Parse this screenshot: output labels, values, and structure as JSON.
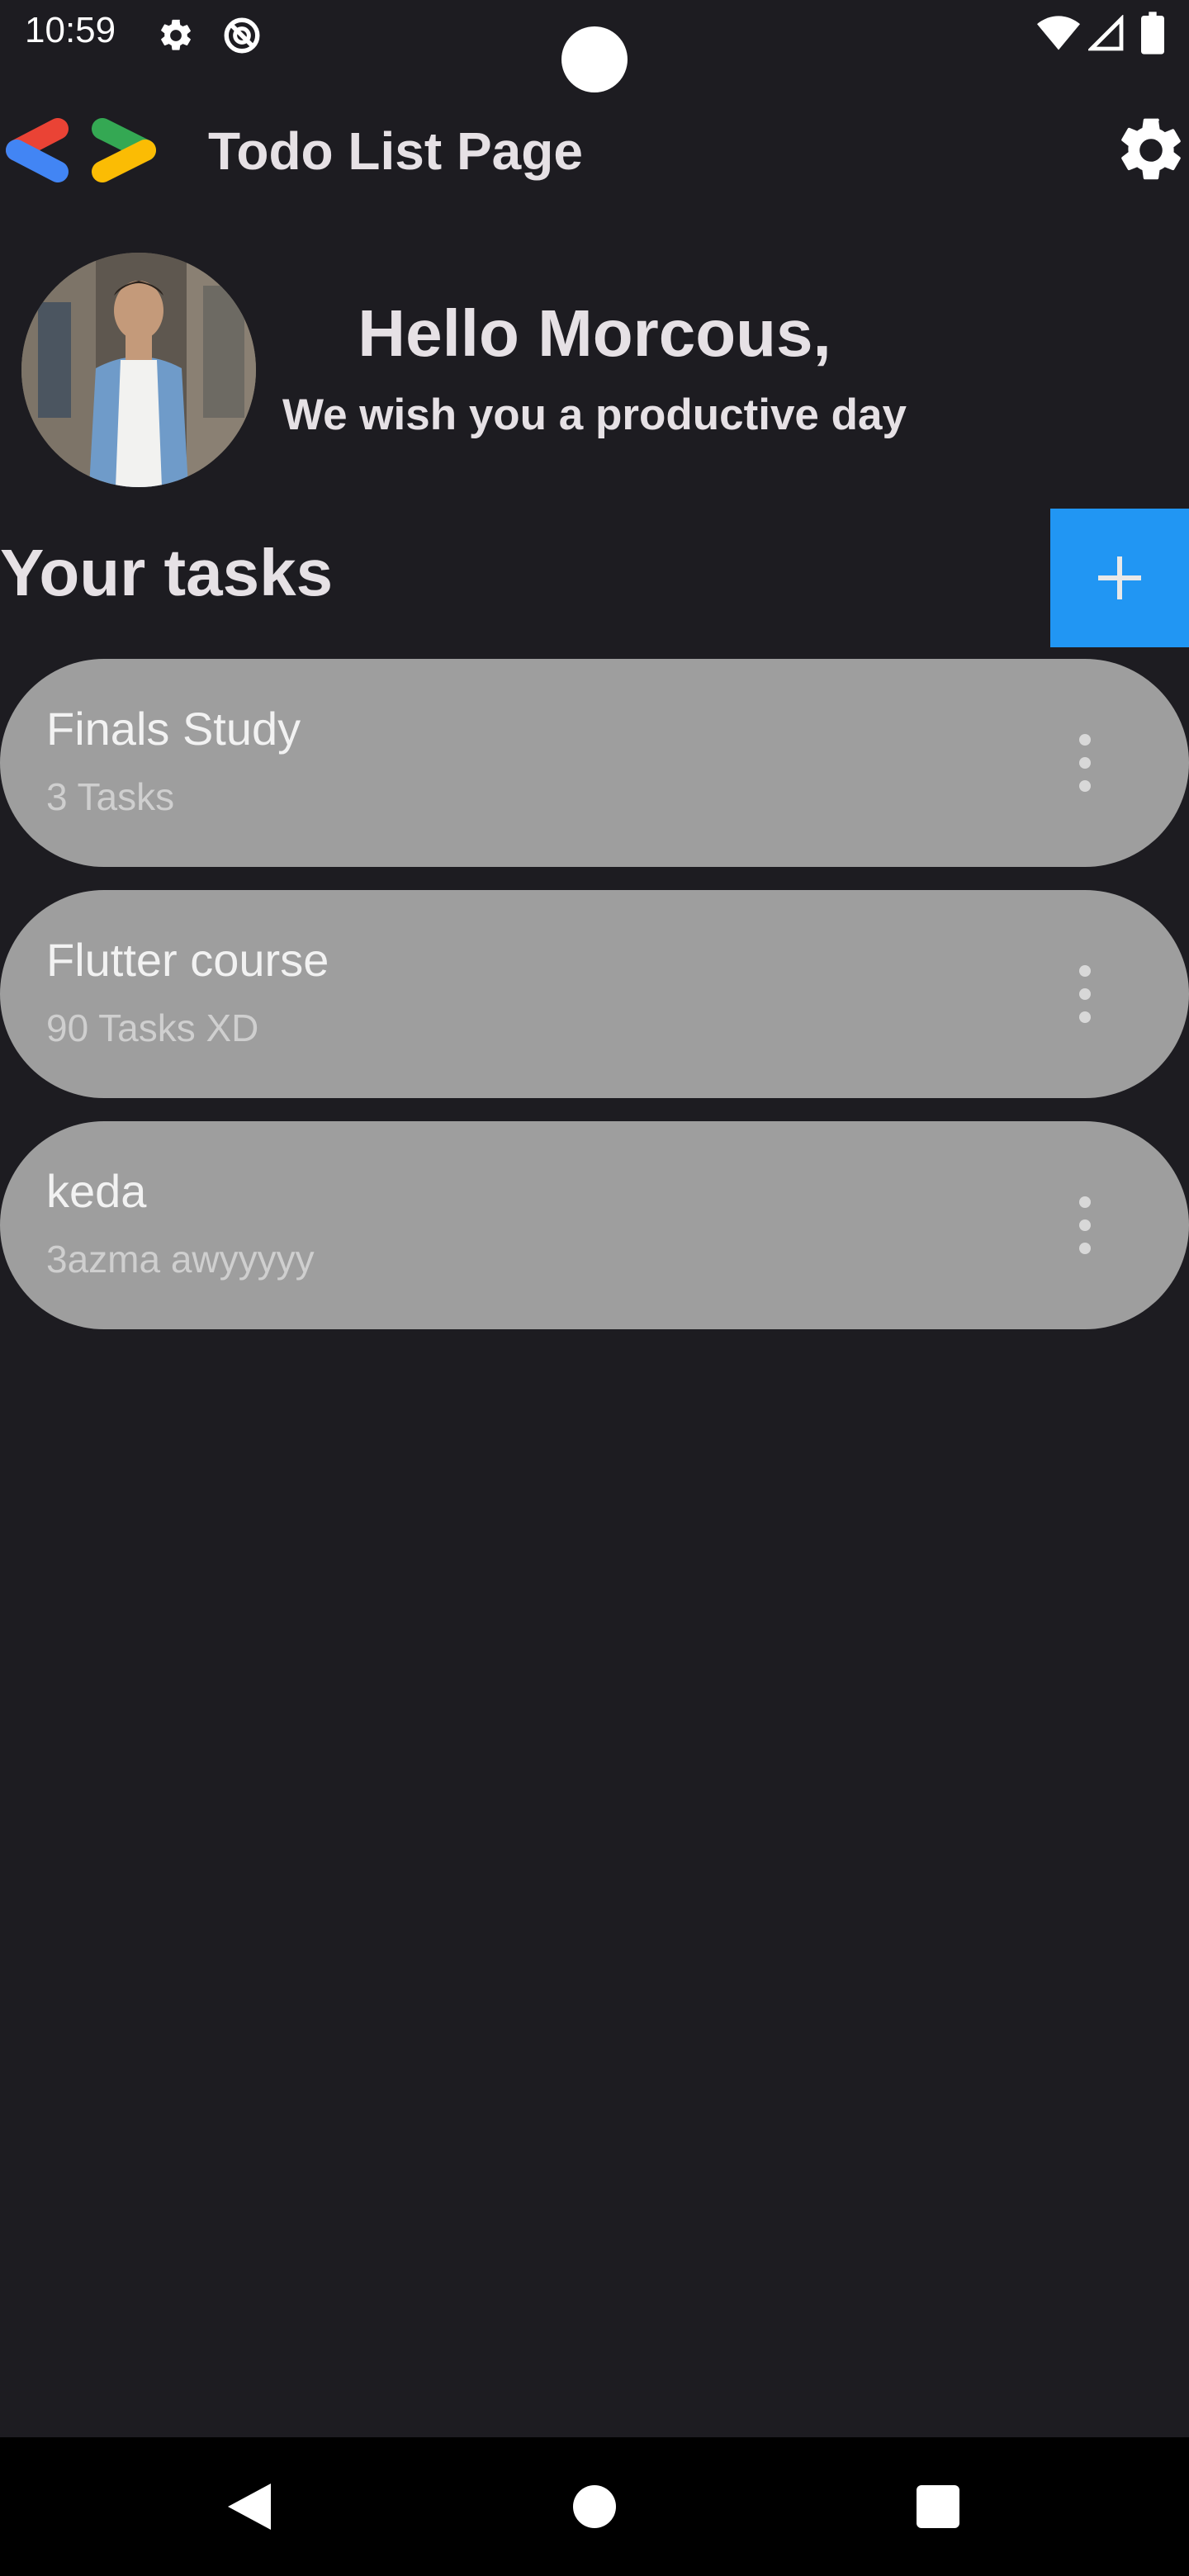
{
  "status_bar": {
    "time": "10:59",
    "icons_left": [
      "gear-icon",
      "no-tracking-icon"
    ],
    "icons_right": [
      "wifi-icon",
      "signal-icon",
      "battery-icon"
    ]
  },
  "app_bar": {
    "title": "Todo List Page",
    "logo": "google-developers-logo",
    "settings_icon": "gear-icon"
  },
  "greeting": {
    "title": "Hello Morcous,",
    "subtitle": "We wish you a productive day"
  },
  "tasks_section": {
    "title": "Your tasks",
    "add_button_icon": "plus-icon"
  },
  "tasks": [
    {
      "title": "Finals Study",
      "subtitle": "3 Tasks"
    },
    {
      "title": "Flutter course",
      "subtitle": "90 Tasks XD"
    },
    {
      "title": "keda",
      "subtitle": "3azma awyyyyy"
    }
  ],
  "nav_bar": {
    "buttons": [
      "back-icon",
      "home-icon",
      "recents-icon"
    ]
  },
  "colors": {
    "background": "#1d1c21",
    "card": "#9e9e9e",
    "accent": "#2196f3",
    "text": "#e6e1e5"
  }
}
